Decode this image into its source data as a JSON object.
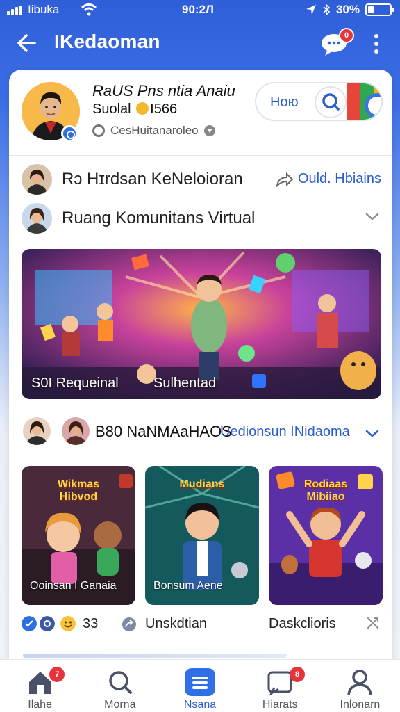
{
  "status_bar": {
    "carrier": "Iibuka",
    "time": "90:2Л",
    "battery": "30%",
    "battery_level": 0.3
  },
  "header": {
    "title": "IKedaoman",
    "chat_badge": "0"
  },
  "profile": {
    "name": "RaUS Pns ntia Anaiи",
    "sub_prefix": "Suolal",
    "sub_value": "I566",
    "location": "CesHuitanarolео",
    "search_label": "Hoю"
  },
  "rows": [
    {
      "label": "Rɔ Hɪrdsan KeNeloioran",
      "action": "Ould. Hbiains"
    },
    {
      "label": "Ruang Komunitans Virtual"
    }
  ],
  "banner": {
    "caption_left": "S0I Requeinal",
    "caption_right": "Sulhentad"
  },
  "group": {
    "count_label": "B80 NaNMAaHAOS",
    "link": "Uedionsun INidaoma"
  },
  "tiles": [
    {
      "title": "Wikmas\nHibvod",
      "caption": "Ooinsan I Ganaia"
    },
    {
      "title": "Mudians",
      "caption": "Bonsum Aene"
    },
    {
      "title": "Rodiaas\nMibiiao",
      "caption": ""
    }
  ],
  "reactions": {
    "count": "33",
    "share_label": "Unskdtian",
    "discuss_label": "Daskclioris"
  },
  "nav": [
    {
      "label": "Ilahe",
      "badge": "7"
    },
    {
      "label": "Morna"
    },
    {
      "label": "Nsana"
    },
    {
      "label": "Hiarats",
      "badge": "8"
    },
    {
      "label": "Inlonarn"
    }
  ],
  "colors": {
    "accent": "#2b5cd0",
    "badge": "#e7333c",
    "header_bg": "#2f5fd8"
  }
}
